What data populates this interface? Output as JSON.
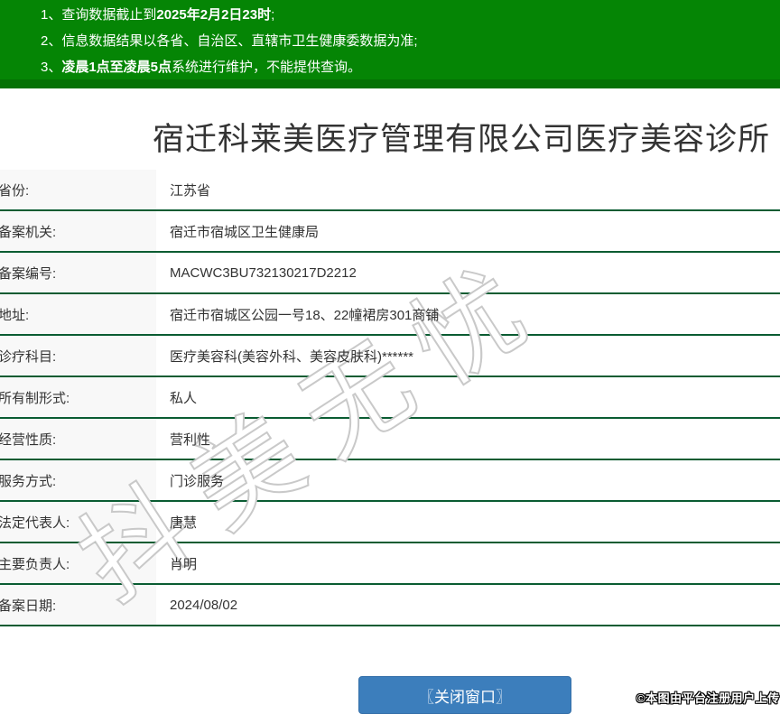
{
  "notices": [
    {
      "num": "1、",
      "pre": "查询数据截止到",
      "bold": "2025年2月2日23时",
      "post": ";"
    },
    {
      "num": "2、",
      "pre": "信息数据结果以各省、自治区、直辖市卫生健康委数据为准;",
      "bold": "",
      "post": ""
    },
    {
      "num": "3、",
      "pre": "",
      "bold": "凌晨1点至凌晨5点",
      "post": "系统进行维护，不能提供查询。"
    }
  ],
  "title": "宿迁科莱美医疗管理有限公司医疗美容诊所",
  "fields": [
    {
      "label": "省份:",
      "value": "江苏省"
    },
    {
      "label": "备案机关:",
      "value": "宿迁市宿城区卫生健康局"
    },
    {
      "label": "备案编号:",
      "value": "MACWC3BU732130217D2212"
    },
    {
      "label": "地址:",
      "value": "宿迁市宿城区公园一号18、22幢裙房301商铺"
    },
    {
      "label": "诊疗科目:",
      "value": "医疗美容科(美容外科、美容皮肤科)******"
    },
    {
      "label": "所有制形式:",
      "value": "私人"
    },
    {
      "label": "经营性质:",
      "value": "营利性"
    },
    {
      "label": "服务方式:",
      "value": "门诊服务"
    },
    {
      "label": "法定代表人:",
      "value": "唐慧"
    },
    {
      "label": "主要负责人:",
      "value": "肖明"
    },
    {
      "label": "备案日期:",
      "value": "2024/08/02"
    }
  ],
  "watermark": "抖美无忧",
  "close_button_label": "〖关闭窗口〗",
  "copyright": "©本图由平台注册用户上传",
  "colors": {
    "header_green": "#058505",
    "header_green_dark": "#047104",
    "divider_green": "#0a5c32",
    "button_blue": "#3c7ebc",
    "label_bg": "#f8f8f8",
    "text": "#333333"
  }
}
